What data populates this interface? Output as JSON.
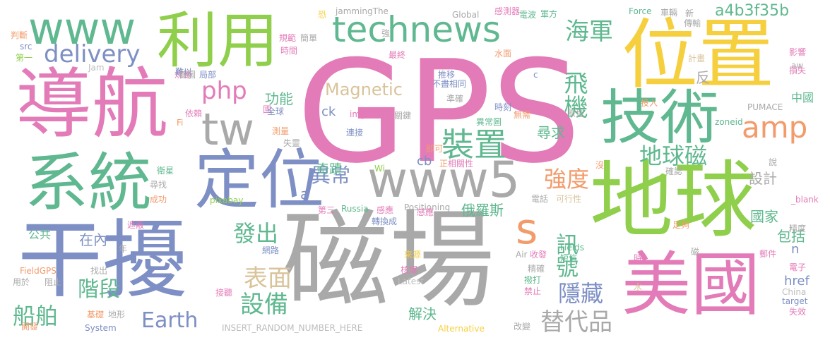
{
  "words": [
    "GPS",
    "磁場",
    "干擾",
    "導航",
    "位置",
    "地球",
    "美國",
    "定位",
    "系統",
    "技術",
    "technews",
    "利用",
    "www",
    "tw",
    "www5",
    "s",
    "delivery",
    "php",
    "amp",
    "裝置",
    "飛機",
    "海軍",
    "地球磁",
    "a4b3f35b",
    "強度",
    "異常",
    "發出",
    "訊號",
    "表面",
    "設備",
    "隱藏",
    "替代品",
    "船舶",
    "階段",
    "Earth",
    "Magnetic",
    "功能",
    "尋求",
    "俄羅斯",
    "奇蹟",
    "國家",
    "設計",
    "包括",
    "在內",
    "公共",
    "解決",
    "cb",
    "ck",
    "n",
    "href",
    "jammingThe",
    "感測器",
    "Global",
    "電波",
    "軍方",
    "Force",
    "車輛",
    "新",
    "傳輸",
    "恐",
    "判斷",
    "規範",
    "簡單",
    "時間",
    "最終",
    "水面",
    "影響",
    "計畫",
    "src",
    "第一",
    "Jam",
    "aw",
    "規劃",
    "局部",
    "難以",
    "首圖",
    "推移",
    "不盡相同",
    "準確",
    "損失",
    "依賴",
    "國",
    "全球",
    "img",
    "關鍵",
    "時刻",
    "無需",
    "原型",
    "投入",
    "Fi",
    "測量",
    "連接",
    "異常圖",
    "即可",
    "zoneid",
    "PUMACE",
    "衛星",
    "失靈",
    "Wi",
    "正",
    "相關性",
    "確認",
    "尋找",
    "成功",
    "pixabay",
    "第三",
    "Russia",
    "感應",
    "Positioning",
    "轉換成",
    "電話",
    "可行性",
    "足夠",
    "精度",
    "遮蔽",
    "年",
    "網路",
    "來源",
    "收發",
    "Air",
    "短信",
    "Fields",
    "郵件",
    "電子",
    "時",
    "磁",
    "FieldGPS",
    "找出",
    "用於",
    "阻止",
    "接聽",
    "Latest",
    "核爆",
    "精確",
    "撥打",
    "禁止",
    "水",
    "China",
    "target",
    "失效",
    "基礎",
    "地形",
    "開發",
    "System",
    "INSERT_RANDOM_NUMBER_HERE",
    "Alternative",
    "改變",
    "_blank",
    "說",
    "沒",
    "a",
    "c",
    "中國",
    "反",
    "強",
    "感應"
  ],
  "colors": {
    "pink": "#e37bb8",
    "green": "#8fcf4c",
    "yellow": "#f6cf3e",
    "gray": "#a9a9a9",
    "teal": "#5fb88f",
    "blue": "#7d8fc4",
    "orange": "#f29b6b",
    "tan": "#d9c39a",
    "lightgreen": "#a6d854",
    "lightgray": "#bdbdbd"
  }
}
